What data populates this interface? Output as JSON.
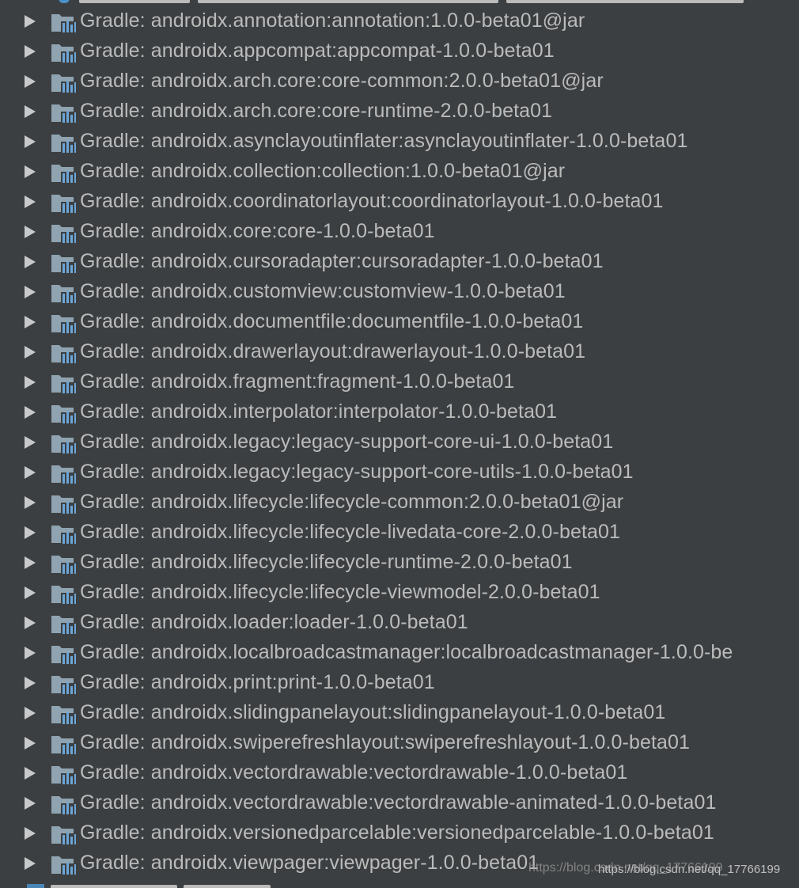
{
  "tree": {
    "items": [
      {
        "label": "Gradle: androidx.annotation:annotation:1.0.0-beta01@jar"
      },
      {
        "label": "Gradle: androidx.appcompat:appcompat-1.0.0-beta01"
      },
      {
        "label": "Gradle: androidx.arch.core:core-common:2.0.0-beta01@jar"
      },
      {
        "label": "Gradle: androidx.arch.core:core-runtime-2.0.0-beta01"
      },
      {
        "label": "Gradle: androidx.asynclayoutinflater:asynclayoutinflater-1.0.0-beta01"
      },
      {
        "label": "Gradle: androidx.collection:collection:1.0.0-beta01@jar"
      },
      {
        "label": "Gradle: androidx.coordinatorlayout:coordinatorlayout-1.0.0-beta01"
      },
      {
        "label": "Gradle: androidx.core:core-1.0.0-beta01"
      },
      {
        "label": "Gradle: androidx.cursoradapter:cursoradapter-1.0.0-beta01"
      },
      {
        "label": "Gradle: androidx.customview:customview-1.0.0-beta01"
      },
      {
        "label": "Gradle: androidx.documentfile:documentfile-1.0.0-beta01"
      },
      {
        "label": "Gradle: androidx.drawerlayout:drawerlayout-1.0.0-beta01"
      },
      {
        "label": "Gradle: androidx.fragment:fragment-1.0.0-beta01"
      },
      {
        "label": "Gradle: androidx.interpolator:interpolator-1.0.0-beta01"
      },
      {
        "label": "Gradle: androidx.legacy:legacy-support-core-ui-1.0.0-beta01"
      },
      {
        "label": "Gradle: androidx.legacy:legacy-support-core-utils-1.0.0-beta01"
      },
      {
        "label": "Gradle: androidx.lifecycle:lifecycle-common:2.0.0-beta01@jar"
      },
      {
        "label": "Gradle: androidx.lifecycle:lifecycle-livedata-core-2.0.0-beta01"
      },
      {
        "label": "Gradle: androidx.lifecycle:lifecycle-runtime-2.0.0-beta01"
      },
      {
        "label": "Gradle: androidx.lifecycle:lifecycle-viewmodel-2.0.0-beta01"
      },
      {
        "label": "Gradle: androidx.loader:loader-1.0.0-beta01"
      },
      {
        "label": "Gradle: androidx.localbroadcastmanager:localbroadcastmanager-1.0.0-be"
      },
      {
        "label": "Gradle: androidx.print:print-1.0.0-beta01"
      },
      {
        "label": "Gradle: androidx.slidingpanelayout:slidingpanelayout-1.0.0-beta01"
      },
      {
        "label": "Gradle: androidx.swiperefreshlayout:swiperefreshlayout-1.0.0-beta01"
      },
      {
        "label": "Gradle: androidx.vectordrawable:vectordrawable-1.0.0-beta01"
      },
      {
        "label": "Gradle: androidx.vectordrawable:vectordrawable-animated-1.0.0-beta01"
      },
      {
        "label": "Gradle: androidx.versionedparcelable:versionedparcelable-1.0.0-beta01"
      },
      {
        "label": "Gradle: androidx.viewpager:viewpager-1.0.0-beta01"
      }
    ],
    "expand_icon": "chevron-right-icon",
    "item_icon": "library-icon"
  },
  "watermark": {
    "text": "https://blog.csdn.net/qq_17766199"
  },
  "colors": {
    "background": "#3c3f41",
    "text": "#bbbbbb",
    "arrow": "#c7c9cb",
    "icon_folder": "#8fa3b0",
    "icon_bars": "#6ca6d8"
  }
}
